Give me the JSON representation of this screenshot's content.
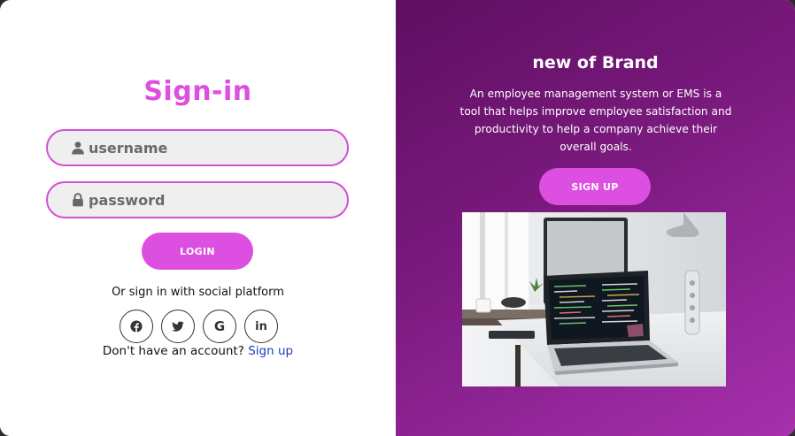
{
  "colors": {
    "accent": "#de4ee0",
    "panel_dark": "#5e0f61",
    "panel_light": "#a730ae",
    "link": "#1a3fb8"
  },
  "signin": {
    "title": "Sign-in",
    "username": {
      "placeholder": "username",
      "icon": "user-icon"
    },
    "password": {
      "placeholder": "password",
      "icon": "lock-icon"
    },
    "login_label": "LOGIN",
    "social_text": "Or sign in with social platform",
    "socials": [
      {
        "name": "facebook",
        "icon": "facebook-icon"
      },
      {
        "name": "twitter",
        "icon": "twitter-icon"
      },
      {
        "name": "google",
        "icon": "google-icon",
        "glyph": "G"
      },
      {
        "name": "linkedin",
        "icon": "linkedin-icon",
        "glyph": "in"
      }
    ],
    "account_prompt": "Don't have an account?",
    "signup_link": "Sign up"
  },
  "brand": {
    "title": "new of Brand",
    "description": "An employee management system or EMS is a tool that helps improve employee satisfaction and productivity to help a company achieve their overall goals.",
    "signup_label": "SIGN UP",
    "image": "laptop-desk-photo"
  }
}
